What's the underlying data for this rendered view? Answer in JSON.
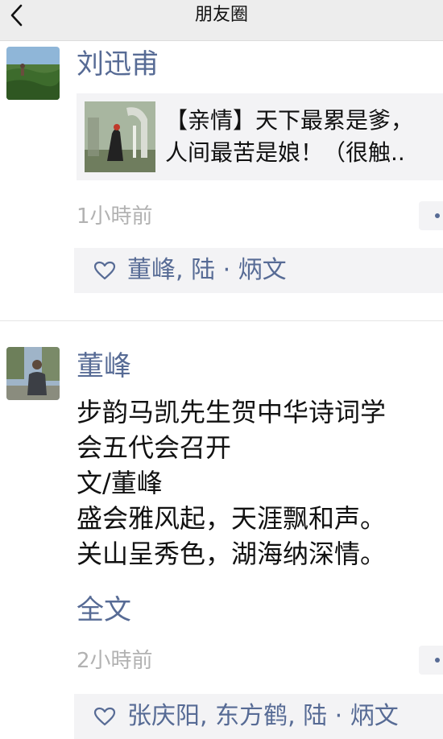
{
  "navbar": {
    "title": "朋友圈"
  },
  "posts": [
    {
      "author": "刘迅甫",
      "share": {
        "line1": "【亲情】天下最累是爹，",
        "line2": "人间最苦是娘！（很触.."
      },
      "time": "1小時前",
      "likes": "董峰, 陆 · 炳文"
    },
    {
      "author": "董峰",
      "text_lines": [
        "步韵马凯先生贺中华诗词学",
        "会五代会召开",
        "文/董峰",
        "盛会雅风起，天涯飘和声。",
        "关山呈秀色，湖海纳深情。"
      ],
      "full_text_label": "全文",
      "time": "2小時前",
      "likes": "张庆阳, 东方鹤, 陆 · 炳文"
    }
  ],
  "colors": {
    "link": "#576b95",
    "time": "#b2b2b2",
    "card_bg": "#f3f3f5",
    "navbar_bg": "#ededed"
  },
  "icons": [
    "back-arrow-icon",
    "heart-icon",
    "more-icon"
  ]
}
